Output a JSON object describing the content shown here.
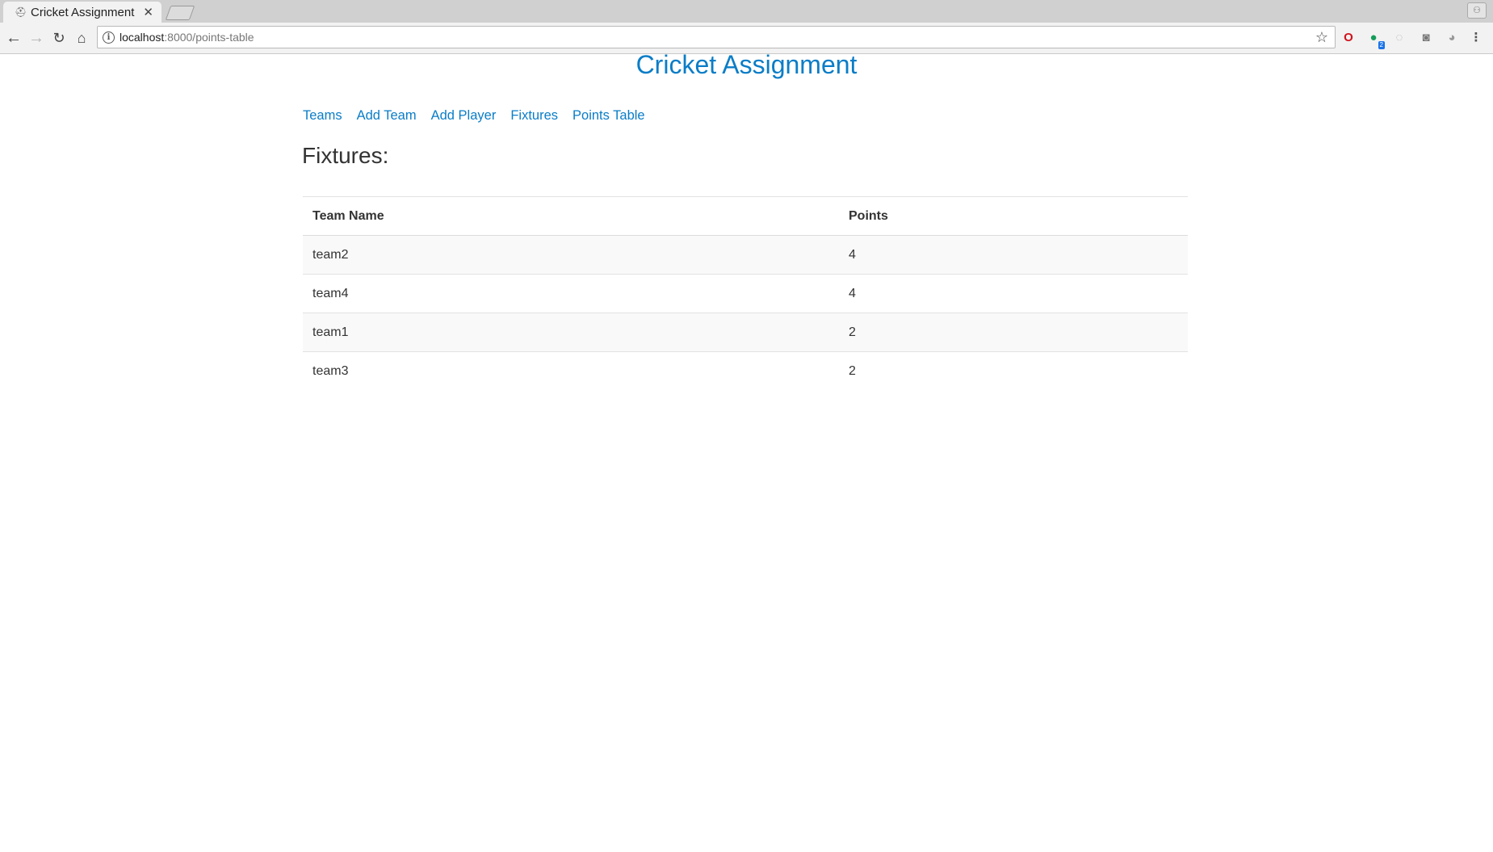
{
  "browser": {
    "tab_title": "Cricket Assignment",
    "url_host": "localhost",
    "url_rest": ":8000/points-table",
    "extension_badge": "2"
  },
  "site": {
    "title": "Cricket Assignment",
    "nav": [
      "Teams",
      "Add Team",
      "Add Player",
      "Fixtures",
      "Points Table"
    ]
  },
  "main": {
    "heading": "Fixtures:",
    "table": {
      "headers": [
        "Team Name",
        "Points"
      ],
      "rows": [
        {
          "team": "team2",
          "points": "4"
        },
        {
          "team": "team4",
          "points": "4"
        },
        {
          "team": "team1",
          "points": "2"
        },
        {
          "team": "team3",
          "points": "2"
        }
      ]
    }
  },
  "colors": {
    "link": "#0a7dc7",
    "text": "#333333",
    "stripe": "#f9f9f9"
  }
}
